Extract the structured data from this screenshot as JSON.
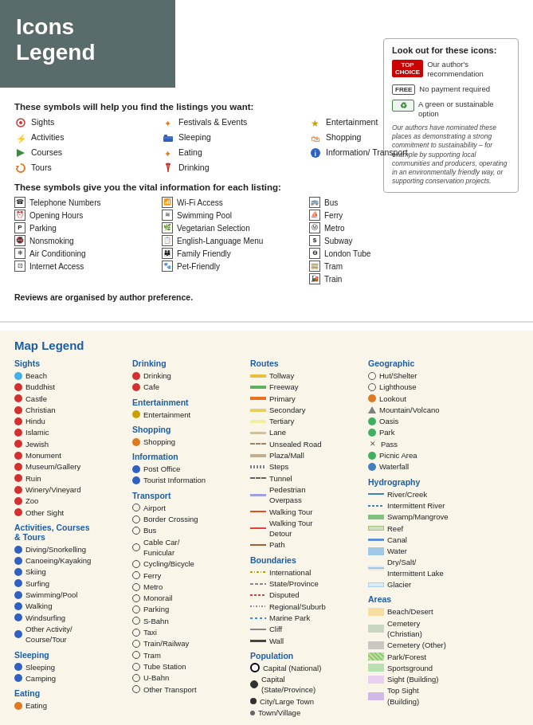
{
  "header": {
    "title_line1": "Icons",
    "title_line2": "Legend"
  },
  "symbols_section": {
    "title": "These symbols will help you find the listings you want:",
    "items_col1": [
      {
        "label": "Sights",
        "icon": "◎",
        "color": "red"
      },
      {
        "label": "Activities",
        "icon": "⚡",
        "color": "orange"
      },
      {
        "label": "Courses",
        "icon": "▶",
        "color": "green"
      },
      {
        "label": "Tours",
        "icon": "↺",
        "color": "orange"
      }
    ],
    "items_col2": [
      {
        "label": "Festivals & Events",
        "icon": "✦",
        "color": "orange"
      },
      {
        "label": "Sleeping",
        "icon": "🛏",
        "color": "blue"
      },
      {
        "label": "Eating",
        "icon": "✦",
        "color": "orange"
      },
      {
        "label": "Drinking",
        "icon": "🍷",
        "color": "red"
      }
    ],
    "items_col3": [
      {
        "label": "Entertainment",
        "icon": "★",
        "color": "yellow"
      },
      {
        "label": "Shopping",
        "icon": "🛍",
        "color": "orange"
      },
      {
        "label": "Information/ Transport",
        "icon": "ℹ",
        "color": "blue"
      }
    ]
  },
  "look_out_box": {
    "title": "Look out for these icons:",
    "items": [
      {
        "badge": "TOP CHOICE",
        "badge_class": "top",
        "desc": "Our author's recommendation"
      },
      {
        "badge": "FREE",
        "badge_class": "free",
        "desc": "No payment required"
      },
      {
        "badge": "♻",
        "badge_class": "green",
        "desc": "A green or sustainable option"
      }
    ],
    "note": "Our authors have nominated these places as demonstrating a strong commitment to sustainability – for example by supporting local communities and producers, operating in an environmentally friendly way, or supporting conservation projects."
  },
  "vital_section": {
    "title": "These symbols give you the vital information for each listing:",
    "items_col1": [
      {
        "label": "Telephone Numbers",
        "icon": "☎"
      },
      {
        "label": "Opening Hours",
        "icon": "⏰"
      },
      {
        "label": "Parking",
        "icon": "P"
      },
      {
        "label": "Nonsmoking",
        "icon": "🚭"
      },
      {
        "label": "Air Conditioning",
        "icon": "❄"
      },
      {
        "label": "Internet Access",
        "icon": "⊡"
      }
    ],
    "items_col2": [
      {
        "label": "Wi-Fi Access",
        "icon": "📶"
      },
      {
        "label": "Swimming Pool",
        "icon": "≋"
      },
      {
        "label": "Vegetarian Selection",
        "icon": "🌿"
      },
      {
        "label": "English-Language Menu",
        "icon": "📋"
      },
      {
        "label": "Family Friendly",
        "icon": "👨‍👩‍👦"
      },
      {
        "label": "Pet-Friendly",
        "icon": "🐾"
      }
    ],
    "items_col3": [
      {
        "label": "Bus",
        "icon": "🚌"
      },
      {
        "label": "Ferry",
        "icon": "⛵"
      },
      {
        "label": "Metro",
        "icon": "Ⓜ"
      },
      {
        "label": "Subway",
        "icon": "S"
      },
      {
        "label": "London Tube",
        "icon": "Ⓣ"
      },
      {
        "label": "Tram",
        "icon": "🚃"
      },
      {
        "label": "Train",
        "icon": "🚂"
      }
    ]
  },
  "reviews_note": "Reviews are organised by author preference.",
  "map_legend": {
    "title": "Map Legend",
    "col1": {
      "sights_title": "Sights",
      "sights": [
        "Beach",
        "Buddhist",
        "Castle",
        "Christian",
        "Hindu",
        "Islamic",
        "Jewish",
        "Monument",
        "Museum/Gallery",
        "Ruin",
        "Winery/Vineyard",
        "Zoo",
        "Other Sight"
      ],
      "activities_title": "Activities, Courses & Tours",
      "activities": [
        "Diving/Snorkelling",
        "Canoeing/Kayaking",
        "Skiing",
        "Surfing",
        "Swimming/Pool",
        "Walking",
        "Windsurfing",
        "Other Activity/Course/Tour"
      ],
      "sleeping_title": "Sleeping",
      "sleeping": [
        "Sleeping",
        "Camping"
      ],
      "eating_title": "Eating",
      "eating": [
        "Eating"
      ]
    },
    "col2": {
      "drinking_title": "Drinking",
      "drinking": [
        "Drinking",
        "Cafe"
      ],
      "entertainment_title": "Entertainment",
      "entertainment": [
        "Entertainment"
      ],
      "shopping_title": "Shopping",
      "shopping": [
        "Shopping"
      ],
      "information_title": "Information",
      "information": [
        "Post Office",
        "Tourist Information"
      ],
      "transport_title": "Transport",
      "transport": [
        "Airport",
        "Border Crossing",
        "Bus",
        "Cable Car/Funicular",
        "Cycling/Bicycle",
        "Ferry",
        "Metro",
        "Monorail",
        "Parking",
        "S-Bahn",
        "Taxi",
        "Train/Railway",
        "Tram",
        "Tube Station",
        "U-Bahn",
        "Other Transport"
      ]
    },
    "col3": {
      "routes_title": "Routes",
      "routes": [
        "Tollway",
        "Freeway",
        "Primary",
        "Secondary",
        "Tertiary",
        "Lane",
        "Unsealed Road",
        "Plaza/Mall",
        "Steps",
        "Tunnel",
        "Pedestrian Overpass",
        "Walking Tour",
        "Walking Tour Detour",
        "Path"
      ],
      "boundaries_title": "Boundaries",
      "boundaries": [
        "International",
        "State/Province",
        "Disputed",
        "Regional/Suburb",
        "Marine Park",
        "Cliff",
        "Wall"
      ],
      "population_title": "Population",
      "population": [
        "Capital (National)",
        "Capital (State/Province)",
        "City/Large Town",
        "Town/Village"
      ]
    },
    "col4": {
      "geographic_title": "Geographic",
      "geographic": [
        "Hut/Shelter",
        "Lighthouse",
        "Lookout",
        "Mountain/Volcano",
        "Oasis",
        "Park",
        "Pass",
        "Picnic Area",
        "Waterfall"
      ],
      "hydrography_title": "Hydrography",
      "hydrography": [
        "River/Creek",
        "Intermittent River",
        "Swamp/Mangrove",
        "Reef",
        "Canal",
        "Water",
        "Dry/Salt/Intermittent Lake",
        "Glacier"
      ],
      "areas_title": "Areas",
      "areas": [
        "Beach/Desert",
        "Cemetery (Christian)",
        "Cemetery (Other)",
        "Park/Forest",
        "Sportsground",
        "Sight (Building)",
        "Top Sight (Building)"
      ]
    }
  }
}
